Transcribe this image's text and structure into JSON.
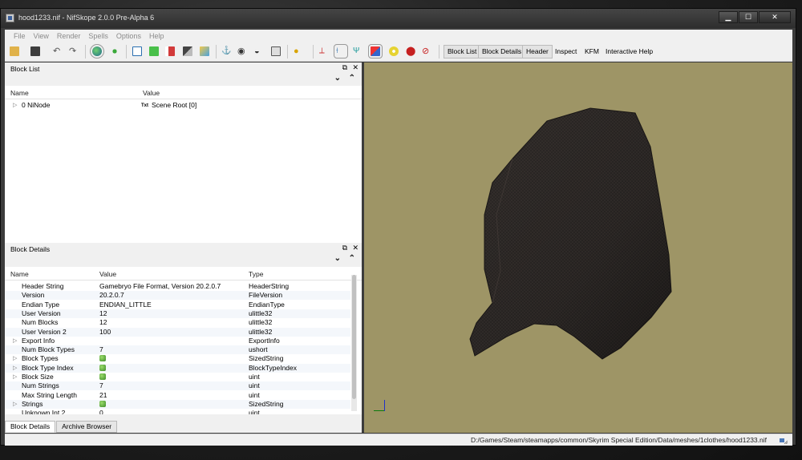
{
  "window": {
    "title": "hood1233.nif - NifSkope 2.0.0 Pre-Alpha 6",
    "minimize": "▁",
    "maximize": "☐",
    "close": "✕"
  },
  "menu": [
    "File",
    "View",
    "Render",
    "Spells",
    "Options",
    "Help"
  ],
  "toolbar": {
    "text_buttons": {
      "block_list": "Block List",
      "block_details": "Block Details",
      "header": "Header",
      "inspect": "Inspect",
      "kfm": "KFM",
      "interactive_help": "Interactive Help"
    }
  },
  "block_list": {
    "title": "Block List",
    "columns": {
      "name": "Name",
      "value": "Value"
    },
    "rows": [
      {
        "name": "0 NiNode",
        "value_prefix": "Txt",
        "value": "Scene Root [0]"
      }
    ]
  },
  "block_details": {
    "title": "Block Details",
    "columns": {
      "name": "Name",
      "value": "Value",
      "type": "Type"
    },
    "rows": [
      {
        "name": "Header String",
        "value": "Gamebryo File Format, Version 20.2.0.7",
        "type": "HeaderString",
        "expandable": false,
        "icon": false
      },
      {
        "name": "Version",
        "value": "20.2.0.7",
        "type": "FileVersion",
        "expandable": false,
        "icon": false
      },
      {
        "name": "Endian Type",
        "value": "ENDIAN_LITTLE",
        "type": "EndianType",
        "expandable": false,
        "icon": false
      },
      {
        "name": "User Version",
        "value": "12",
        "type": "ulittle32",
        "expandable": false,
        "icon": false
      },
      {
        "name": "Num Blocks",
        "value": "12",
        "type": "ulittle32",
        "expandable": false,
        "icon": false
      },
      {
        "name": "User Version 2",
        "value": "100",
        "type": "ulittle32",
        "expandable": false,
        "icon": false
      },
      {
        "name": "Export Info",
        "value": "",
        "type": "ExportInfo",
        "expandable": true,
        "icon": false
      },
      {
        "name": "Num Block Types",
        "value": "7",
        "type": "ushort",
        "expandable": false,
        "icon": false
      },
      {
        "name": "Block Types",
        "value": "",
        "type": "SizedString",
        "expandable": true,
        "icon": true
      },
      {
        "name": "Block Type Index",
        "value": "",
        "type": "BlockTypeIndex",
        "expandable": true,
        "icon": true
      },
      {
        "name": "Block Size",
        "value": "",
        "type": "uint",
        "expandable": true,
        "icon": true
      },
      {
        "name": "Num Strings",
        "value": "7",
        "type": "uint",
        "expandable": false,
        "icon": false
      },
      {
        "name": "Max String Length",
        "value": "21",
        "type": "uint",
        "expandable": false,
        "icon": false
      },
      {
        "name": "Strings",
        "value": "",
        "type": "SizedString",
        "expandable": true,
        "icon": true
      },
      {
        "name": "Unknown Int 2",
        "value": "0",
        "type": "uint",
        "expandable": false,
        "icon": false
      }
    ]
  },
  "bottom_tabs": [
    "Block Details",
    "Archive Browser"
  ],
  "status": {
    "path": "D:/Games/Steam/steamapps/common/Skyrim Special Edition/Data/meshes/1clothes/hood1233.nif"
  },
  "colors": {
    "viewport_bg": "#9e9566",
    "mesh": "#2a2624"
  }
}
